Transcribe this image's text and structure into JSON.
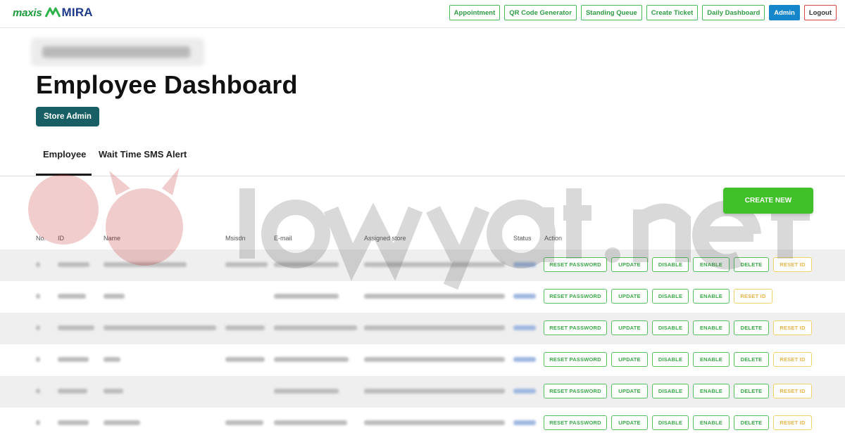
{
  "header": {
    "logo_left": "maxis",
    "logo_right": "MIRA",
    "nav": [
      "Appointment",
      "QR Code Generator",
      "Standing Queue",
      "Create Ticket",
      "Daily Dashboard",
      "Admin",
      "Logout"
    ]
  },
  "page": {
    "title": "Employee Dashboard",
    "store_admin": "Store Admin"
  },
  "tabs": [
    "Employee",
    "Wait Time SMS Alert"
  ],
  "create_new": "CREATE NEW",
  "table": {
    "columns": [
      "No.",
      "ID",
      "Name",
      "Msisdn",
      "E-mail",
      "Assigned store",
      "Status",
      "Action"
    ],
    "actions": {
      "reset_password": "RESET PASSWORD",
      "update": "UPDATE",
      "disable": "DISABLE",
      "enable": "ENABLE",
      "delete": "DELETE",
      "reset_id": "RESET ID"
    }
  },
  "colors": {
    "brand_green": "#40c12a",
    "store_admin_teal": "#175f64",
    "admin_blue": "#1486c9",
    "reset_id_yellow": "#e6b54a"
  }
}
